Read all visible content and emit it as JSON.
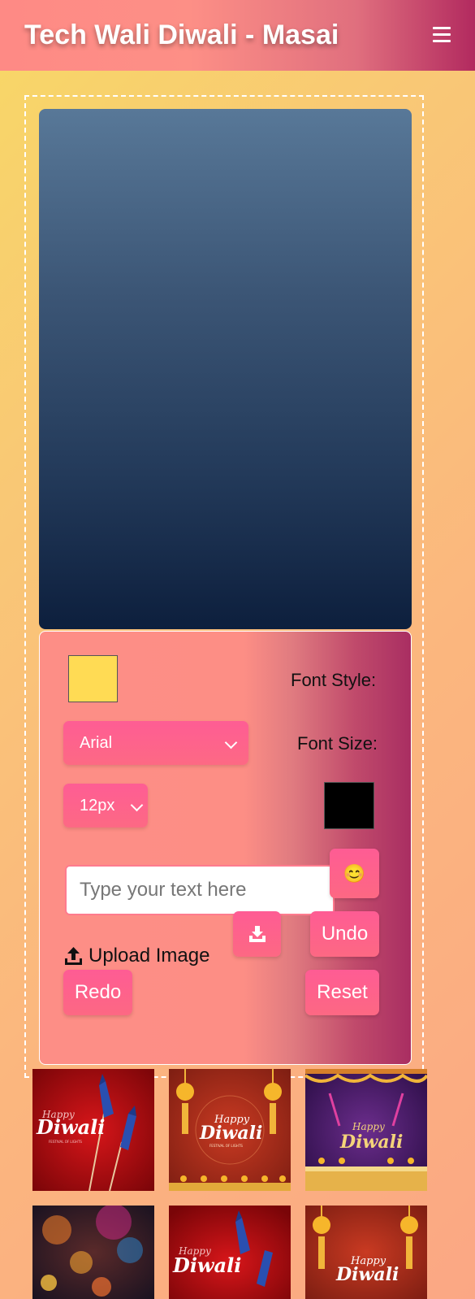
{
  "header": {
    "title": "Tech Wali Diwali - Masai",
    "menu_icon": "hamburger-menu-icon"
  },
  "controls": {
    "text_color": "#ffdb54",
    "background_color": "#000000",
    "font_style_label": "Font Style:",
    "font_size_label": "Font Size:",
    "font_family_value": "Arial",
    "font_size_value": "12px",
    "text_placeholder": "Type your text here",
    "emoji": "😊",
    "upload_label": "Upload Image",
    "undo_label": "Undo",
    "redo_label": "Redo",
    "reset_label": "Reset"
  },
  "gallery": {
    "thumbnails": [
      {
        "happy": "Happy",
        "diwali": "Diwali",
        "subtitle": "FESTIVAL OF LIGHTS"
      },
      {
        "happy": "Happy",
        "diwali": "Diwali",
        "subtitle": "FESTIVAL OF LIGHTS"
      },
      {
        "happy": "Happy",
        "diwali": "Diwali"
      },
      {},
      {
        "happy": "Happy",
        "diwali": "Diwali"
      },
      {
        "happy": "Happy",
        "diwali": "Diwali"
      }
    ]
  }
}
